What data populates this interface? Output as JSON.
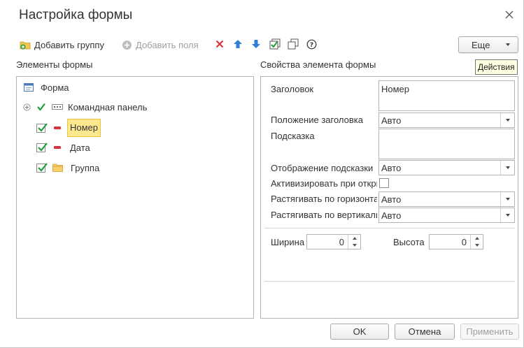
{
  "window": {
    "title": "Настройка формы",
    "close_icon": "close-icon"
  },
  "toolbar": {
    "add_group_label": "Добавить группу",
    "add_fields_label": "Добавить поля",
    "more_label": "Еще",
    "tooltip": "Действия",
    "icons": [
      "delete-icon",
      "move-up-icon",
      "move-down-icon",
      "check-all-icon",
      "copy-icon",
      "help-icon"
    ]
  },
  "left_panel": {
    "title": "Элементы формы",
    "tree": [
      {
        "label": "Форма",
        "icon": "form-icon",
        "checked": false
      },
      {
        "label": "Командная панель",
        "icon": "command-bar-icon",
        "checked": true
      },
      {
        "label": "Номер",
        "icon": "field-icon",
        "checked": true,
        "selected": true
      },
      {
        "label": "Дата",
        "icon": "field-icon",
        "checked": true
      },
      {
        "label": "Группа",
        "icon": "folder-icon",
        "checked": true
      }
    ]
  },
  "right_panel": {
    "title": "Свойства элемента формы",
    "props": {
      "title_label": "Заголовок",
      "title_value": "Номер",
      "title_position_label": "Положение заголовка",
      "title_position_value": "Авто",
      "hint_label": "Подсказка",
      "hint_value": "",
      "hint_display_label": "Отображение подсказки",
      "hint_display_value": "Авто",
      "activate_label": "Активизировать при откры",
      "activate_checked": false,
      "stretch_h_label": "Растягивать по горизонтали",
      "stretch_h_value": "Авто",
      "stretch_v_label": "Растягивать по вертикали",
      "stretch_v_value": "Авто",
      "width_label": "Ширина",
      "width_value": "0",
      "height_label": "Высота",
      "height_value": "0"
    }
  },
  "footer": {
    "ok": "OK",
    "cancel": "Отмена",
    "apply": "Применить"
  },
  "colors": {
    "selection_bg": "#fde88f",
    "selection_border": "#f0c23a",
    "check_green": "#1f9d3b",
    "delete_red": "#d9333f",
    "arrow_blue": "#2f7fd8"
  }
}
